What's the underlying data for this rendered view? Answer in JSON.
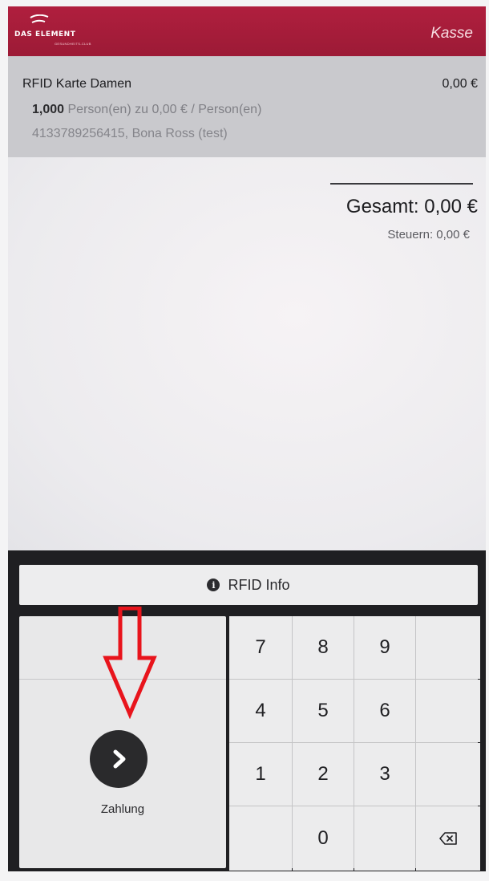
{
  "header": {
    "logo_text": "DAS ELEMENT",
    "logo_subtext": "GESUNDHEITS-CLUB",
    "title": "Kasse"
  },
  "order": {
    "item_name": "RFID Karte Damen",
    "item_price": "0,00 €",
    "quantity": "1,000",
    "unit_text": "Person(en) zu 0,00 € / Person(en)",
    "card_info": "4133789256415, Bona Ross (test)"
  },
  "summary": {
    "total": "Gesamt: 0,00 €",
    "taxes": "Steuern: 0,00 €"
  },
  "actions": {
    "rfid_info": "RFID Info",
    "pay_label": "Zahlung"
  },
  "keypad": {
    "k7": "7",
    "k8": "8",
    "k9": "9",
    "k4": "4",
    "k5": "5",
    "k6": "6",
    "k1": "1",
    "k2": "2",
    "k3": "3",
    "k0": "0"
  },
  "colors": {
    "header": "#b01f3e",
    "panel": "#1f1f22",
    "annotation": "#e8141c"
  },
  "icons": {
    "info": "info-circle-icon",
    "pay": "chevron-right-circle-icon",
    "backspace": "backspace-icon",
    "annotation": "red-arrow-down-icon"
  }
}
